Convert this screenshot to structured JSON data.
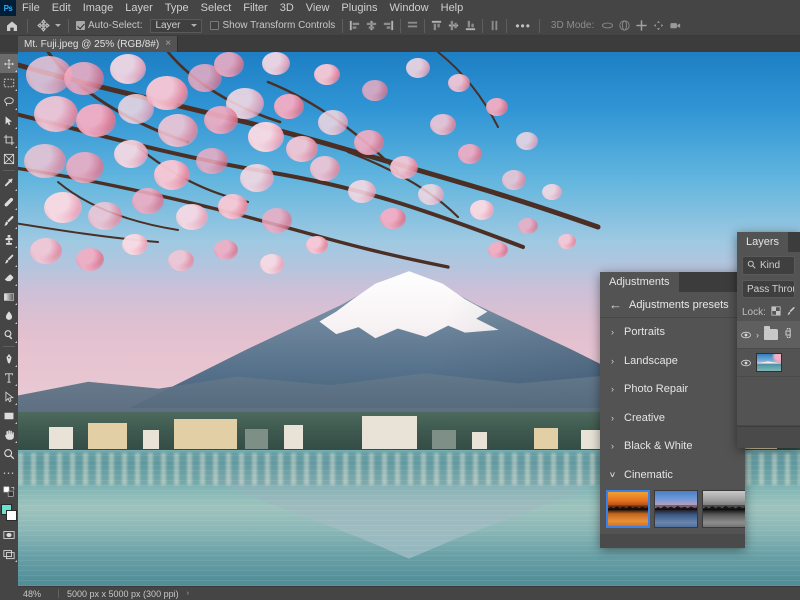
{
  "app": {
    "name": "Adobe Photoshop",
    "logo_text": "Ps"
  },
  "menubar": {
    "items": [
      {
        "label": "File"
      },
      {
        "label": "Edit"
      },
      {
        "label": "Image"
      },
      {
        "label": "Layer"
      },
      {
        "label": "Type"
      },
      {
        "label": "Select"
      },
      {
        "label": "Filter"
      },
      {
        "label": "3D"
      },
      {
        "label": "View"
      },
      {
        "label": "Plugins"
      },
      {
        "label": "Window"
      },
      {
        "label": "Help"
      }
    ]
  },
  "options_bar": {
    "home_icon": "home-icon",
    "tool_icon": "move-tool-icon",
    "auto_select_label": "Auto-Select:",
    "auto_select_checked": true,
    "auto_select_scope": "Layer",
    "show_transform_label": "Show Transform Controls",
    "show_transform_checked": false,
    "more_options": "•••",
    "mode_3d_label": "3D Mode:"
  },
  "tabs": {
    "documents": [
      {
        "title": "Mt. Fuji.jpeg @ 25% (RGB/8#)",
        "close": "×",
        "active": true
      }
    ]
  },
  "toolbar": {
    "tools": [
      {
        "name": "move-tool",
        "selected": true,
        "has_flyout": true
      },
      {
        "name": "rectangular-marquee-tool",
        "selected": false,
        "has_flyout": true
      },
      {
        "name": "lasso-tool",
        "selected": false,
        "has_flyout": true
      },
      {
        "name": "object-selection-tool",
        "selected": false,
        "has_flyout": true
      },
      {
        "name": "crop-tool",
        "selected": false,
        "has_flyout": true
      },
      {
        "name": "frame-tool",
        "selected": false,
        "has_flyout": false
      },
      {
        "name": "eyedropper-tool",
        "selected": false,
        "has_flyout": true
      },
      {
        "name": "spot-healing-brush-tool",
        "selected": false,
        "has_flyout": true
      },
      {
        "name": "brush-tool",
        "selected": false,
        "has_flyout": true
      },
      {
        "name": "clone-stamp-tool",
        "selected": false,
        "has_flyout": true
      },
      {
        "name": "history-brush-tool",
        "selected": false,
        "has_flyout": true
      },
      {
        "name": "eraser-tool",
        "selected": false,
        "has_flyout": true
      },
      {
        "name": "gradient-tool",
        "selected": false,
        "has_flyout": true
      },
      {
        "name": "blur-tool",
        "selected": false,
        "has_flyout": true
      },
      {
        "name": "dodge-tool",
        "selected": false,
        "has_flyout": true
      },
      {
        "name": "pen-tool",
        "selected": false,
        "has_flyout": true
      },
      {
        "name": "type-tool",
        "selected": false,
        "has_flyout": true
      },
      {
        "name": "path-selection-tool",
        "selected": false,
        "has_flyout": true
      },
      {
        "name": "rectangle-tool",
        "selected": false,
        "has_flyout": true
      },
      {
        "name": "hand-tool",
        "selected": false,
        "has_flyout": true
      },
      {
        "name": "zoom-tool",
        "selected": false,
        "has_flyout": false
      },
      {
        "name": "edit-toolbar-tool",
        "selected": false,
        "has_flyout": false
      }
    ],
    "foreground_color": "#6ee0d0",
    "background_color": "#ffffff",
    "quick_mask_name": "quick-mask-mode",
    "screen_mode_name": "screen-mode"
  },
  "adjustments_panel": {
    "tab_label": "Adjustments",
    "header_label": "Adjustments presets",
    "back_arrow": "←",
    "categories": [
      {
        "label": "Portraits",
        "expanded": false,
        "chevron": "›"
      },
      {
        "label": "Landscape",
        "expanded": false,
        "chevron": "›"
      },
      {
        "label": "Photo Repair",
        "expanded": false,
        "chevron": "›"
      },
      {
        "label": "Creative",
        "expanded": false,
        "chevron": "›"
      },
      {
        "label": "Black & White",
        "expanded": false,
        "chevron": "›"
      },
      {
        "label": "Cinematic",
        "expanded": true,
        "chevron": "∨"
      }
    ],
    "presets": [
      {
        "name": "cinematic-preset-1",
        "selected": true
      },
      {
        "name": "cinematic-preset-2",
        "selected": false
      },
      {
        "name": "cinematic-preset-3",
        "selected": false
      },
      {
        "name": "cinematic-preset-4",
        "selected": false
      },
      {
        "name": "cinematic-preset-5",
        "selected": false
      }
    ],
    "selection_color": "#3b82e8"
  },
  "layers_panel": {
    "tab_label": "Layers",
    "filter_label": "Kind",
    "search_icon": "search-icon",
    "blend_mode": "Pass Through",
    "lock_label": "Lock:",
    "lock_icons": [
      "transparency-lock-icon",
      "brush-lock-icon",
      "position-lock-icon"
    ],
    "rows": [
      {
        "name": "layer-group",
        "type": "group",
        "visible": true,
        "selected": true,
        "expand_chevron": "›",
        "link_icon": "link-icon"
      },
      {
        "name": "image-layer",
        "type": "image",
        "visible": true,
        "selected": false
      }
    ]
  },
  "status_bar": {
    "zoom": "48%",
    "doc_dimensions": "5000 px x 5000 px (300 ppi)",
    "arrow": "›"
  },
  "canvas": {
    "image_description": "Mt. Fuji with cherry blossoms and lake reflection",
    "document_zoom": "25%"
  }
}
